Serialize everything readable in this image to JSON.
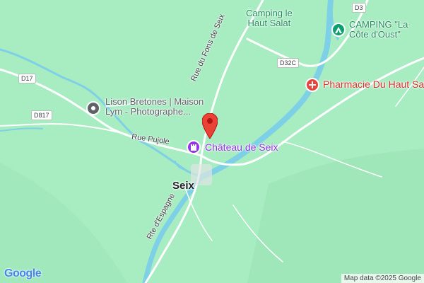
{
  "map": {
    "colors": {
      "land": "#a8ecc2",
      "water": "#7ed0e6",
      "road": "#ffffff",
      "poi_gray": "#5f6368",
      "poi_green": "#0d9f6e",
      "poi_purple": "#9334e6",
      "poi_red": "#e8433f",
      "marker_red": "#ea4335"
    },
    "town": "Seix",
    "roads": {
      "rue_pujole": "Rue Pujole",
      "rue_fons": "Rue du Fons de Seix",
      "rte_espagne": "Rte d'Espagne"
    },
    "shields": {
      "d17": "D17",
      "d817": "D817",
      "d32c": "D32C",
      "d3": "D3"
    },
    "pois": {
      "camping_haut_salat": {
        "line1": "Camping le",
        "line2": "Haut Salat"
      },
      "camping_cote": {
        "line1": "CAMPING \"La",
        "line2": "Côte d'Oust\"",
        "icon": "tent-icon"
      },
      "pharmacie": {
        "name": "Pharmacie Du Haut Salat",
        "icon": "pharmacy-icon"
      },
      "lison": {
        "line1": "Lison Bretones | Maison",
        "line2": "Lym - Photographe...",
        "icon": "pin-icon"
      },
      "chateau": {
        "name": "Château de Seix",
        "icon": "castle-icon"
      }
    },
    "marker": "location-marker",
    "google_logo": "Google",
    "attribution": "Map data ©2025 Google"
  }
}
